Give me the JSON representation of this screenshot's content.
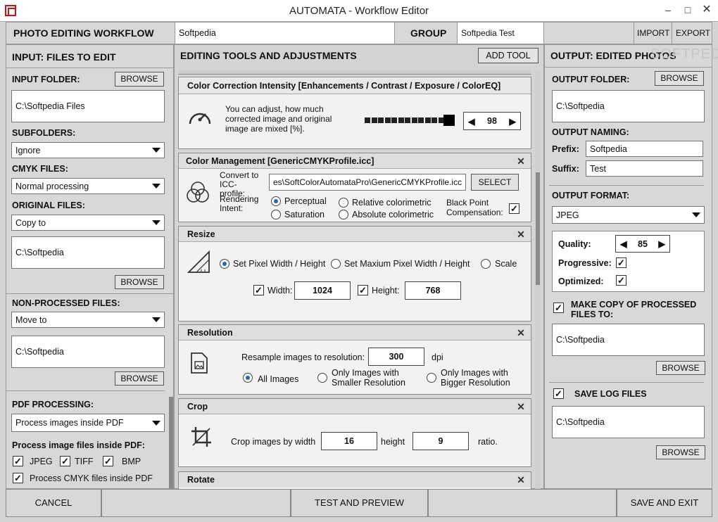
{
  "window": {
    "title": "AUTOMATA - Workflow Editor"
  },
  "topbar": {
    "workflow_label": "PHOTO EDITING WORKFLOW",
    "workflow_name": "Softpedia",
    "group_label": "GROUP",
    "group_name": "Softpedia Test",
    "import_label": "IMPORT",
    "export_label": "EXPORT"
  },
  "left": {
    "header": "INPUT: FILES TO EDIT",
    "input_folder_label": "INPUT FOLDER:",
    "browse": "BROWSE",
    "input_folder": "C:\\Softpedia Files",
    "subfolders_label": "SUBFOLDERS:",
    "subfolders_value": "Ignore",
    "cmyk_label": "CMYK FILES:",
    "cmyk_value": "Normal  processing",
    "original_label": "ORIGINAL FILES:",
    "original_value": "Copy to",
    "original_path": "C:\\Softpedia",
    "nonproc_label": "NON-PROCESSED FILES:",
    "nonproc_value": "Move to",
    "nonproc_path": "C:\\Softpedia",
    "pdf_label": "PDF PROCESSING:",
    "pdf_value": "Process images inside PDF",
    "pdf_files_label": "Process image files inside PDF:",
    "jpeg": "JPEG",
    "tiff": "TIFF",
    "bmp": "BMP",
    "cmyk_pdf": "Process CMYK files inside PDF"
  },
  "center": {
    "header": "EDITING TOOLS AND ADJUSTMENTS",
    "add_tool": "ADD TOOL",
    "color_intensity": {
      "title": "Color Correction Intensity [Enhancements / Contrast / Exposure / ColorEQ]",
      "desc": "You can adjust, how much corrected image and original image are mixed [%].",
      "value": "98",
      "level": 0.98
    },
    "color_mgmt": {
      "title": "Color Management   [GenericCMYKProfile.icc]",
      "convert_label": "Convert to ICC-profile:",
      "profile_path": "es\\SoftColorAutomataPro\\GenericCMYKProfile.icc",
      "select": "SELECT",
      "rendering_label": "Rendering Intent:",
      "perceptual": "Perceptual",
      "relative": "Relative colorimetric",
      "saturation": "Saturation",
      "absolute": "Absolute colorimetric",
      "bpc_label": "Black Point Compensation:"
    },
    "resize": {
      "title": "Resize",
      "opt1": "Set Pixel Width / Height",
      "opt2": "Set Maxium Pixel Width / Height",
      "opt3": "Scale",
      "width_label": "Width:",
      "width": "1024",
      "height_label": "Height:",
      "height": "768"
    },
    "resolution": {
      "title": "Resolution",
      "resample_label": "Resample images to resolution:",
      "value": "300",
      "unit": "dpi",
      "opt1": "All Images",
      "opt2": "Only Images with Smaller Resolution",
      "opt3": "Only Images with Bigger  Resolution"
    },
    "crop": {
      "title": "Crop",
      "label": "Crop images by width",
      "width": "16",
      "height_label": "height",
      "height": "9",
      "ratio": "ratio."
    },
    "rotate": {
      "title": "Rotate"
    }
  },
  "right": {
    "header": "OUTPUT: EDITED PHOTOS",
    "output_folder_label": "OUTPUT FOLDER:",
    "browse": "BROWSE",
    "output_folder": "C:\\Softpedia",
    "naming_label": "OUTPUT NAMING:",
    "prefix_label": "Prefix:",
    "prefix": "Softpedia",
    "suffix_label": "Suffix:",
    "suffix": "Test",
    "format_label": "OUTPUT FORMAT:",
    "format": "JPEG",
    "quality_label": "Quality:",
    "quality": "85",
    "progressive_label": "Progressive:",
    "optimized_label": "Optimized:",
    "copy_label": "MAKE COPY OF PROCESSED FILES TO:",
    "copy_path": "C:\\Softpedia",
    "log_label": "SAVE LOG FILES",
    "log_path": "C:\\Softpedia"
  },
  "bottom": {
    "cancel": "CANCEL",
    "test": "TEST AND PREVIEW",
    "save": "SAVE AND EXIT"
  }
}
